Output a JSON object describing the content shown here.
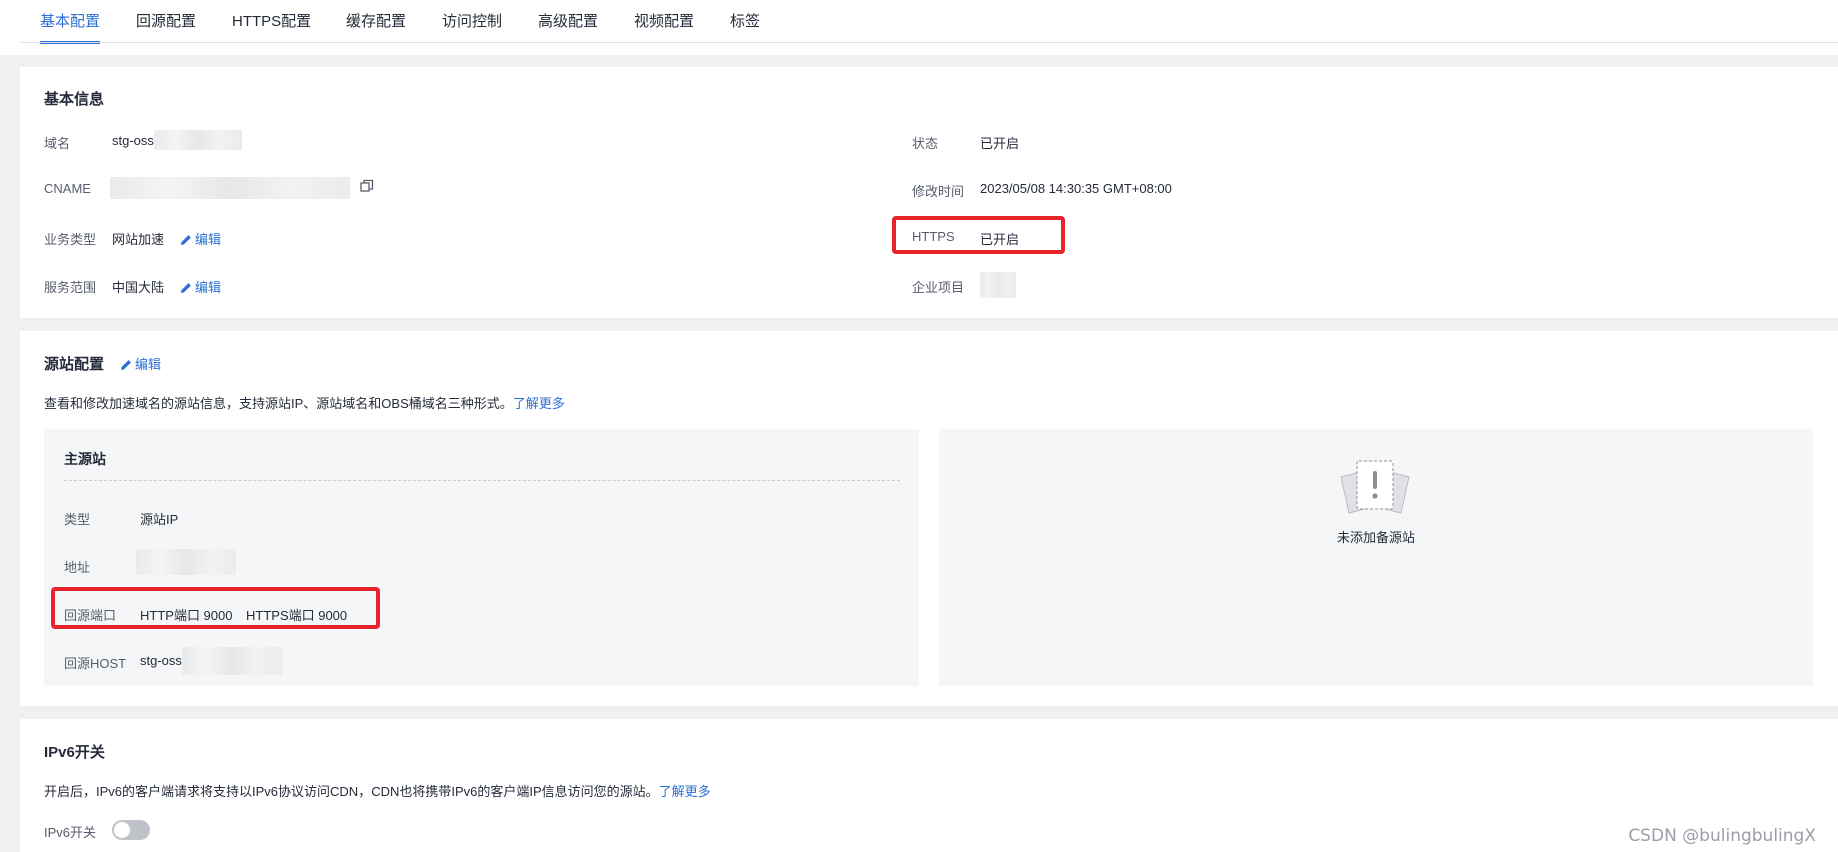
{
  "tabs": [
    {
      "label": "基本配置",
      "active": true
    },
    {
      "label": "回源配置"
    },
    {
      "label": "HTTPS配置"
    },
    {
      "label": "缓存配置"
    },
    {
      "label": "访问控制"
    },
    {
      "label": "高级配置"
    },
    {
      "label": "视频配置"
    },
    {
      "label": "标签"
    }
  ],
  "basic_info": {
    "title": "基本信息",
    "domain_label": "域名",
    "domain_value": "stg-oss.",
    "cname_label": "CNAME",
    "service_type_label": "业务类型",
    "service_type_value": "网站加速",
    "service_scope_label": "服务范围",
    "service_scope_value": "中国大陆",
    "edit_label": "编辑",
    "status_label": "状态",
    "status_value": "已开启",
    "modified_label": "修改时间",
    "modified_value": "2023/05/08 14:30:35 GMT+08:00",
    "https_label": "HTTPS",
    "https_value": "已开启",
    "project_label": "企业项目"
  },
  "origin": {
    "title": "源站配置",
    "edit_label": "编辑",
    "description": "查看和修改加速域名的源站信息，支持源站IP、源站域名和OBS桶域名三种形式。",
    "learn_more": "了解更多",
    "primary": {
      "title": "主源站",
      "type_label": "类型",
      "type_value": "源站IP",
      "address_label": "地址",
      "port_label": "回源端口",
      "http_port": "HTTP端口 9000",
      "https_port": "HTTPS端口 9000",
      "host_label": "回源HOST",
      "host_value": "stg-oss."
    },
    "backup_empty_text": "未添加备源站"
  },
  "ipv6": {
    "title": "IPv6开关",
    "description": "开启后，IPv6的客户端请求将支持以IPv6协议访问CDN，CDN也将携带IPv6的客户端IP信息访问您的源站。",
    "learn_more": "了解更多",
    "switch_label": "IPv6开关",
    "enabled": false
  },
  "watermark": "CSDN @bulingbulingX",
  "colors": {
    "accent": "#2d6fd6",
    "highlight_box": "#e8232b"
  }
}
